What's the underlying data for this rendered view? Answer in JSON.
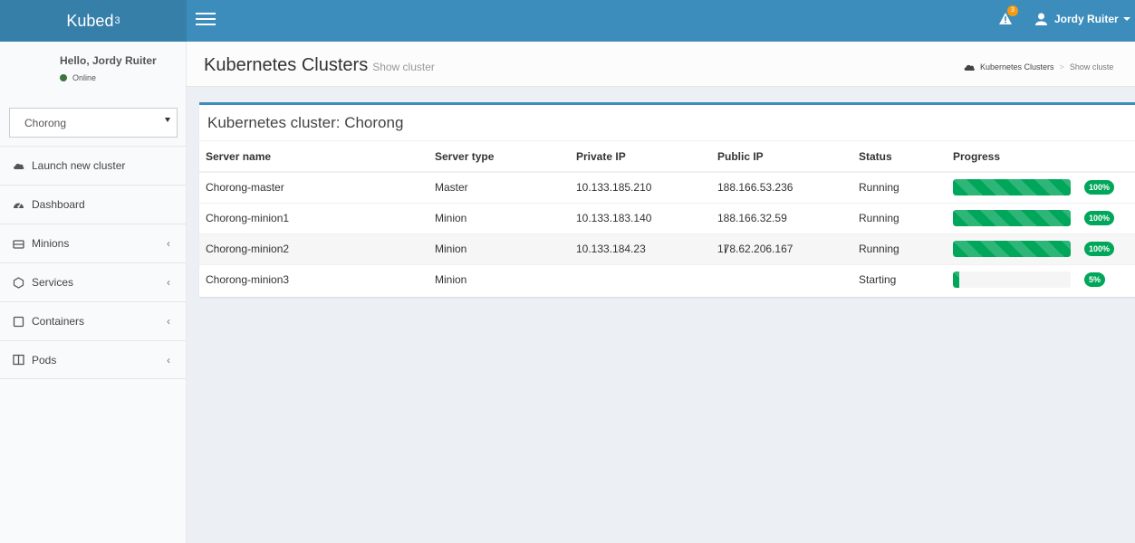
{
  "header": {
    "logo_text": "Kubed",
    "logo_sup": "3",
    "alert_count": "3",
    "user_name": "Jordy Ruiter"
  },
  "sidebar": {
    "greeting": "Hello, Jordy Ruiter",
    "status": "Online",
    "cluster_selected": "Chorong",
    "items": [
      {
        "label": "Launch new cluster",
        "icon": "cloud-icon",
        "submenu": false
      },
      {
        "label": "Dashboard",
        "icon": "dashboard-icon",
        "submenu": false
      },
      {
        "label": "Minions",
        "icon": "server-icon",
        "submenu": true
      },
      {
        "label": "Services",
        "icon": "hexagon-icon",
        "submenu": true
      },
      {
        "label": "Containers",
        "icon": "square-icon",
        "submenu": true
      },
      {
        "label": "Pods",
        "icon": "columns-icon",
        "submenu": true
      }
    ]
  },
  "content_header": {
    "title": "Kubernetes Clusters",
    "subtitle": "Show cluster",
    "breadcrumb": [
      "Kubernetes Clusters",
      "Show cluste"
    ]
  },
  "box": {
    "title": "Kubernetes cluster: Chorong",
    "columns": [
      "Server name",
      "Server type",
      "Private IP",
      "Public IP",
      "Status",
      "Progress"
    ],
    "rows": [
      {
        "name": "Chorong-master",
        "type": "Master",
        "private_ip": "10.133.185.210",
        "public_ip": "188.166.53.236",
        "status": "Running",
        "progress": 100,
        "progress_label": "100%"
      },
      {
        "name": "Chorong-minion1",
        "type": "Minion",
        "private_ip": "10.133.183.140",
        "public_ip": "188.166.32.59",
        "status": "Running",
        "progress": 100,
        "progress_label": "100%"
      },
      {
        "name": "Chorong-minion2",
        "type": "Minion",
        "private_ip": "10.133.184.23",
        "public_ip": "178.62.206.167",
        "status": "Running",
        "progress": 100,
        "progress_label": "100%"
      },
      {
        "name": "Chorong-minion3",
        "type": "Minion",
        "private_ip": "",
        "public_ip": "",
        "status": "Starting",
        "progress": 5,
        "progress_label": "5%"
      }
    ]
  },
  "colors": {
    "navbar": "#3c8dbc",
    "logo_bg": "#367fa9",
    "success": "#00a65a",
    "alert_badge": "#f39c12"
  }
}
